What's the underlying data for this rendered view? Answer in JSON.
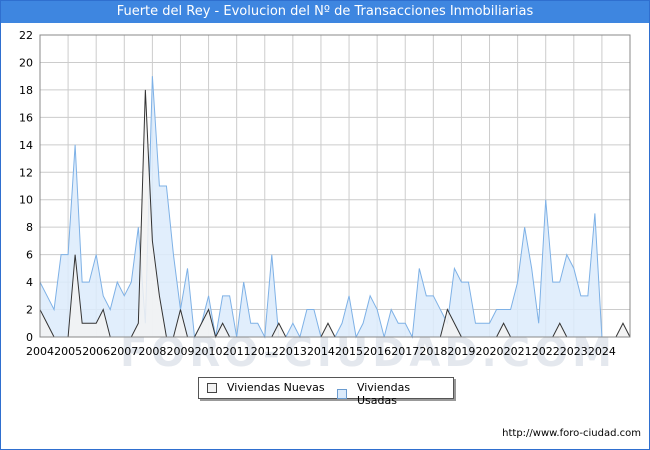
{
  "header": {
    "title": "Fuerte del Rey - Evolucion del Nº de Transacciones Inmobiliarias"
  },
  "watermark": "FORO-CIUDAD.COM",
  "credit": "http://www.foro-ciudad.com",
  "colors": {
    "title_bg": "#3e86e0",
    "nuevas_fill": "#f2f2f2",
    "nuevas_line": "#333333",
    "usadas_fill": "#dcebfb",
    "usadas_line": "#7eb1e6",
    "grid": "#cccccc"
  },
  "chart_data": {
    "type": "area",
    "title": "Fuerte del Rey - Evolucion del Nº de Transacciones Inmobiliarias",
    "x_labels": [
      "2004",
      "2005",
      "2006",
      "2007",
      "2008",
      "2009",
      "2010",
      "2011",
      "2012",
      "2013",
      "2014",
      "2015",
      "2016",
      "2017",
      "2018",
      "2019",
      "2020",
      "2021",
      "2022",
      "2023",
      "2024"
    ],
    "quarters_per_year": 4,
    "ylim": [
      0,
      22
    ],
    "yticks": [
      0,
      2,
      4,
      6,
      8,
      10,
      12,
      14,
      16,
      18,
      20,
      22
    ],
    "grid": true,
    "legend_position": "bottom-center",
    "series": [
      {
        "name": "Viviendas Nuevas",
        "values": [
          2,
          1,
          0,
          0,
          0,
          6,
          1,
          1,
          1,
          2,
          0,
          0,
          0,
          0,
          1,
          18,
          7,
          3,
          0,
          0,
          2,
          0,
          0,
          1,
          2,
          0,
          1,
          0,
          0,
          0,
          0,
          0,
          0,
          0,
          1,
          0,
          0,
          0,
          0,
          0,
          0,
          1,
          0,
          0,
          0,
          0,
          0,
          0,
          0,
          0,
          0,
          0,
          0,
          0,
          0,
          0,
          0,
          0,
          2,
          1,
          0,
          0,
          0,
          0,
          0,
          0,
          1,
          0,
          0,
          0,
          0,
          0,
          0,
          0,
          1,
          0,
          0,
          0,
          0,
          0,
          0,
          0,
          0,
          1,
          0
        ]
      },
      {
        "name": "Viviendas Usadas",
        "values": [
          4,
          3,
          2,
          6,
          6,
          14,
          4,
          4,
          6,
          3,
          2,
          4,
          3,
          4,
          8,
          1,
          19,
          11,
          11,
          6,
          2,
          5,
          0,
          1,
          3,
          0,
          3,
          3,
          0,
          4,
          1,
          1,
          0,
          6,
          0,
          0,
          1,
          0,
          2,
          2,
          0,
          0,
          0,
          1,
          3,
          0,
          1,
          3,
          2,
          0,
          2,
          1,
          1,
          0,
          5,
          3,
          3,
          2,
          1,
          5,
          4,
          4,
          1,
          1,
          1,
          2,
          2,
          2,
          4,
          8,
          5,
          1,
          10,
          4,
          4,
          6,
          5,
          3,
          3,
          9,
          0
        ]
      }
    ]
  }
}
